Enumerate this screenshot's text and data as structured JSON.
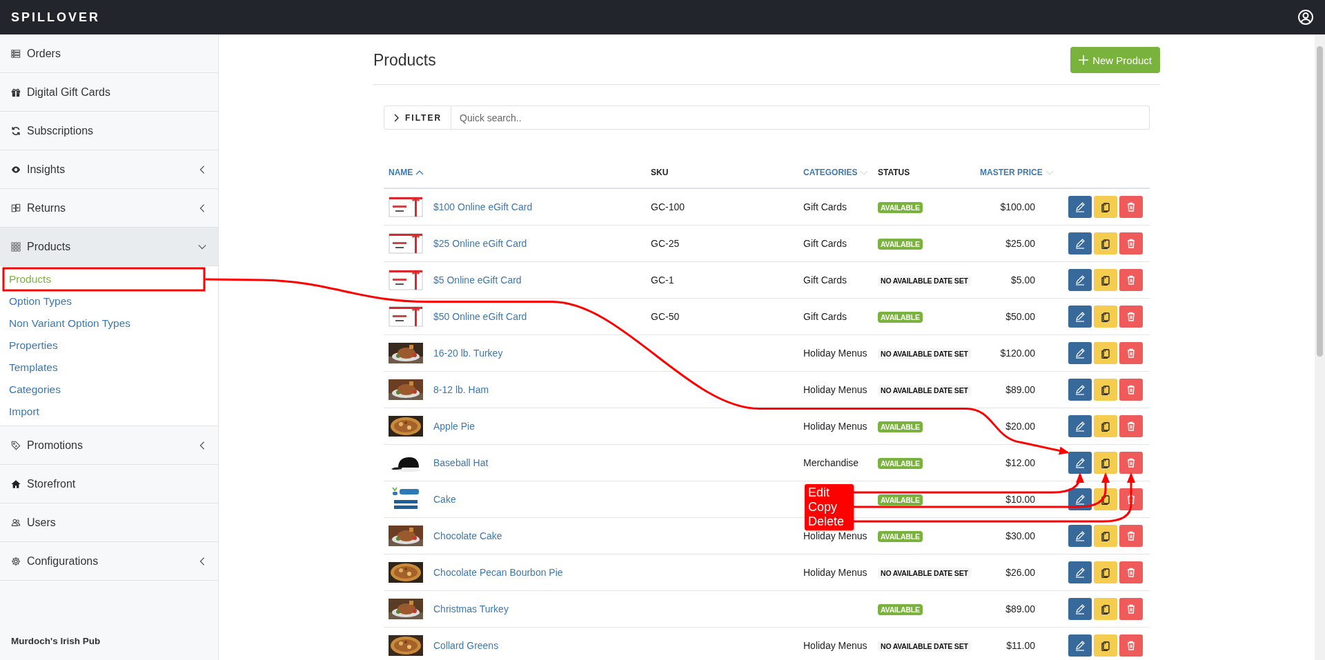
{
  "topbar": {
    "logo": "SPILLOVER"
  },
  "sidebar": {
    "items": [
      {
        "label": "Orders"
      },
      {
        "label": "Digital Gift Cards"
      },
      {
        "label": "Subscriptions"
      },
      {
        "label": "Insights",
        "expanded": false
      },
      {
        "label": "Returns",
        "expanded": false
      },
      {
        "label": "Products",
        "expanded": true,
        "children": [
          {
            "label": "Products",
            "selected": true,
            "outlined": true
          },
          {
            "label": "Option Types",
            "selected": false
          },
          {
            "label": "Non Variant Option Types",
            "selected": false
          },
          {
            "label": "Properties",
            "selected": false
          },
          {
            "label": "Templates",
            "selected": false
          },
          {
            "label": "Categories",
            "selected": false
          },
          {
            "label": "Import",
            "selected": false
          }
        ]
      },
      {
        "label": "Promotions",
        "expanded": false
      },
      {
        "label": "Storefront"
      },
      {
        "label": "Users"
      },
      {
        "label": "Configurations",
        "expanded": false
      }
    ],
    "footer": "Murdoch's Irish Pub"
  },
  "page": {
    "title": "Products",
    "new_button": "New Product",
    "filter": {
      "label": "FILTER",
      "placeholder": "Quick search.."
    }
  },
  "table": {
    "columns": [
      {
        "label": "NAME",
        "sortable": true,
        "sorted": true
      },
      {
        "label": "SKU",
        "sortable": false,
        "sorted": false
      },
      {
        "label": "CATEGORIES",
        "sortable": true,
        "sorted": false
      },
      {
        "label": "STATUS",
        "sortable": false,
        "sorted": false
      },
      {
        "label": "MASTER PRICE",
        "sortable": true,
        "sorted": false
      }
    ],
    "rows": [
      {
        "name": "$100 Online eGift Card",
        "sku": "GC-100",
        "category": "Gift Cards",
        "status": {
          "kind": "available",
          "text": "AVAILABLE"
        },
        "price": "$100.00"
      },
      {
        "name": "$25 Online eGift Card",
        "sku": "GC-25",
        "category": "Gift Cards",
        "status": {
          "kind": "available",
          "text": "AVAILABLE"
        },
        "price": "$25.00"
      },
      {
        "name": "$5 Online eGift Card",
        "sku": "GC-1",
        "category": "Gift Cards",
        "status": {
          "kind": "unset",
          "text": "NO AVAILABLE DATE SET"
        },
        "price": "$5.00"
      },
      {
        "name": "$50 Online eGift Card",
        "sku": "GC-50",
        "category": "Gift Cards",
        "status": {
          "kind": "available",
          "text": "AVAILABLE"
        },
        "price": "$50.00"
      },
      {
        "name": "16-20 lb. Turkey",
        "category": "Holiday Menus",
        "status": {
          "kind": "unset",
          "text": "NO AVAILABLE DATE SET"
        },
        "price": "$120.00"
      },
      {
        "name": "8-12 lb. Ham",
        "category": "Holiday Menus",
        "status": {
          "kind": "unset",
          "text": "NO AVAILABLE DATE SET"
        },
        "price": "$89.00"
      },
      {
        "name": "Apple Pie",
        "category": "Holiday Menus",
        "status": {
          "kind": "available",
          "text": "AVAILABLE"
        },
        "price": "$20.00"
      },
      {
        "name": "Baseball Hat",
        "category": "Merchandise",
        "status": {
          "kind": "available",
          "text": "AVAILABLE"
        },
        "price": "$12.00",
        "annotated": true
      },
      {
        "name": "Cake",
        "status": {
          "kind": "available",
          "text": "AVAILABLE"
        },
        "price": "$10.00"
      },
      {
        "name": "Chocolate Cake",
        "category": "Holiday Menus",
        "status": {
          "kind": "available",
          "text": "AVAILABLE"
        },
        "price": "$30.00"
      },
      {
        "name": "Chocolate Pecan Bourbon Pie",
        "category": "Holiday Menus",
        "status": {
          "kind": "unset",
          "text": "NO AVAILABLE DATE SET"
        },
        "price": "$26.00"
      },
      {
        "name": "Christmas Turkey",
        "status": {
          "kind": "available",
          "text": "AVAILABLE"
        },
        "price": "$89.00"
      },
      {
        "name": "Collard Greens",
        "category": "Holiday Menus",
        "status": {
          "kind": "unset",
          "text": "NO AVAILABLE DATE SET"
        },
        "price": "$11.00"
      }
    ]
  },
  "annotations": {
    "callout_lines": [
      "Edit",
      "Copy",
      "Delete"
    ]
  }
}
